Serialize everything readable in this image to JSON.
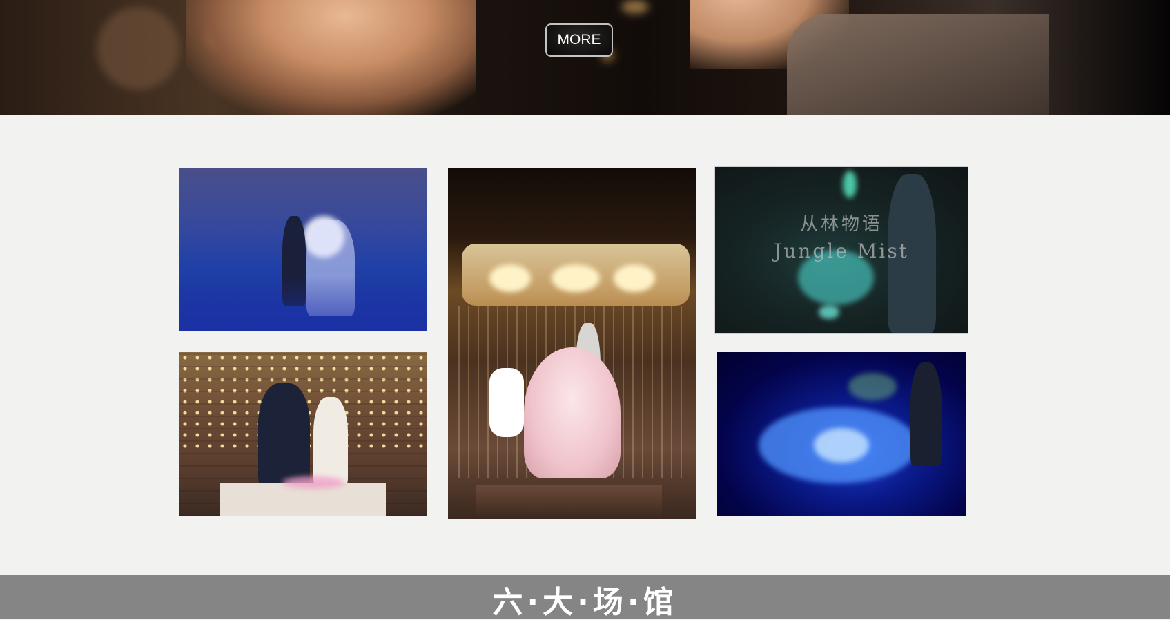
{
  "hero": {
    "more_label": "MORE"
  },
  "gallery": {
    "overlay_cn": "从林物语",
    "overlay_en": "Jungle Mist"
  },
  "section": {
    "title": "六·大·场·馆"
  }
}
